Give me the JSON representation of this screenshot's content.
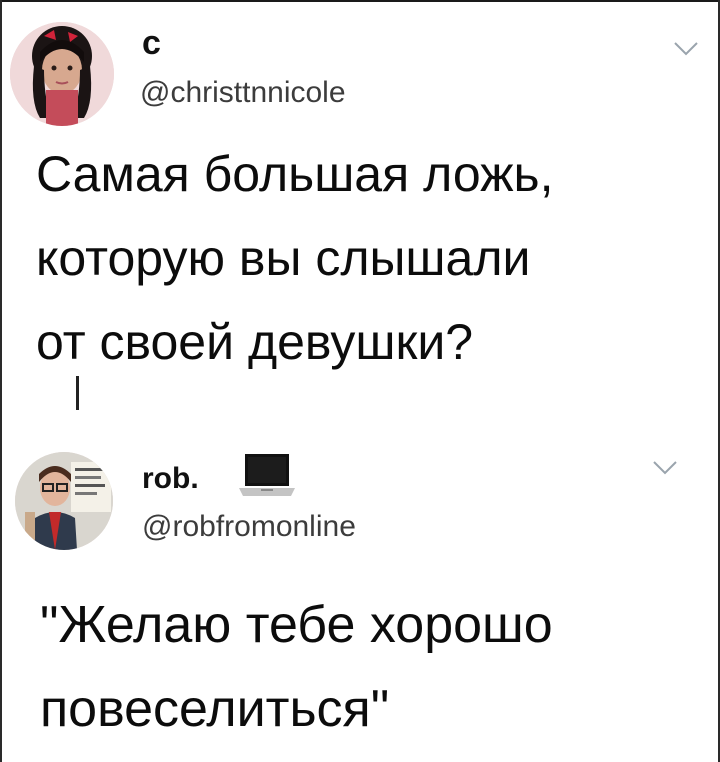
{
  "tweets": [
    {
      "display_name": "с",
      "handle": "@christtnnicole",
      "text": "Самая большая ложь,\nкоторую вы слышали\nот своей девушки?",
      "avatar_icon": "profile-photo",
      "menu_icon": "chevron-down-icon"
    },
    {
      "display_name": "rob.",
      "name_emoji": "laptop-icon",
      "handle": "@robfromonline",
      "text": "\"Желаю тебе хорошо\nповеселиться\"",
      "avatar_icon": "profile-photo",
      "menu_icon": "chevron-down-icon"
    }
  ],
  "colors": {
    "background": "#ffffff",
    "text": "#0c0c0c",
    "handle": "#3c3c3c",
    "chevron": "#9aa4ad"
  }
}
